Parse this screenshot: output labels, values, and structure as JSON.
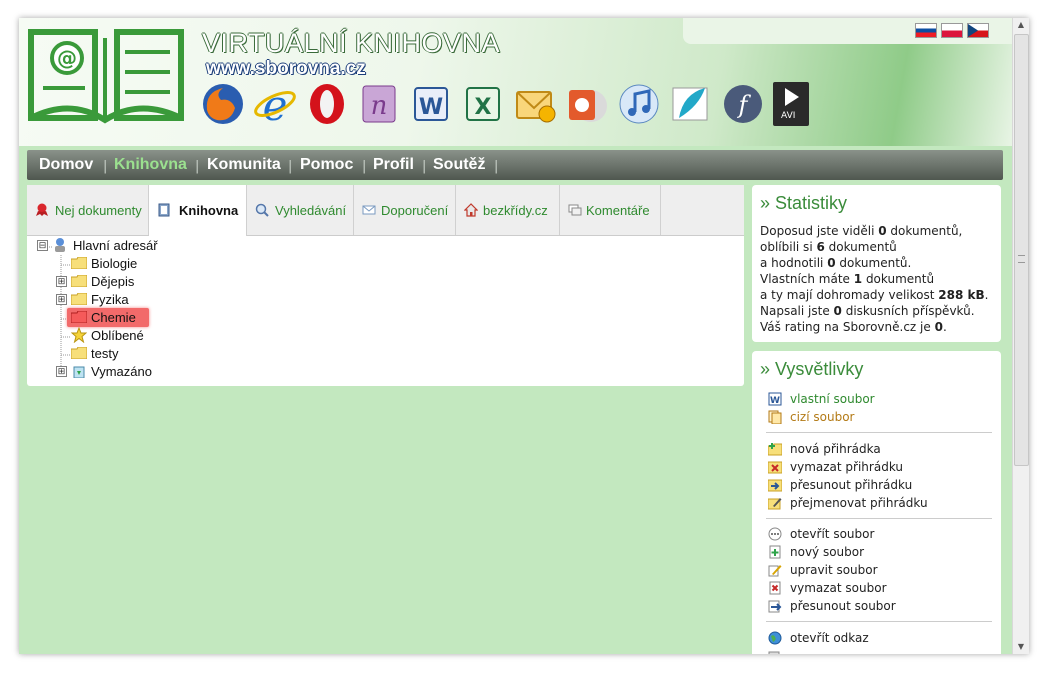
{
  "header": {
    "site_title": "VIRTUÁLNÍ KNIHOVNA",
    "site_url": "www.sborovna.cz",
    "languages": [
      "SK",
      "PL",
      "CZ"
    ],
    "app_icons": [
      "firefox-icon",
      "internet-explorer-icon",
      "opera-icon",
      "onenote-icon",
      "word-icon",
      "excel-icon",
      "outlook-icon",
      "powerpoint-icon",
      "music-icon",
      "feather-icon",
      "flash-icon",
      "avi-icon"
    ],
    "avi_label": "AVI"
  },
  "nav": {
    "items": [
      "Domov",
      "Knihovna",
      "Komunita",
      "Pomoc",
      "Profil",
      "Soutěž"
    ],
    "active": "Knihovna",
    "separator": "|"
  },
  "tabs": [
    "Nej dokumenty",
    "Knihovna",
    "Vyhledávání",
    "Doporučení",
    "bezkřídy.cz",
    "Komentáře"
  ],
  "active_tab": "Knihovna",
  "tree": {
    "root": "Hlavní adresář",
    "items": [
      "Biologie",
      "Dějepis",
      "Fyzika",
      "Chemie",
      "Oblíbené",
      "testy",
      "Vymazáno"
    ],
    "selected": "Chemie",
    "expanders": [
      "⊟",
      "⊞",
      "⊞",
      "⊞"
    ]
  },
  "stats": {
    "title": "» Statistiky",
    "lines": [
      {
        "a": "Doposud jste viděli ",
        "b": "0",
        "c": " dokumentů,"
      },
      {
        "a": "oblíbili si ",
        "b": "6",
        "c": " dokumentů"
      },
      {
        "a": "a hodnotili ",
        "b": "0",
        "c": " dokumentů."
      },
      {
        "a": "Vlastních máte ",
        "b": "1",
        "c": " dokumentů"
      },
      {
        "a": "a ty mají dohromady velikost ",
        "b": "288 kB",
        "c": "."
      },
      {
        "a": "Napsali jste ",
        "b": "0",
        "c": " diskusních příspěvků."
      },
      {
        "a": "Váš rating na Sborovně.cz je ",
        "b": "0",
        "c": "."
      }
    ]
  },
  "legend": {
    "title": "» Vysvětlivky",
    "files": [
      "vlastní soubor",
      "cizí soubor"
    ],
    "folders": [
      "nová přihrádka",
      "vymazat přihrádku",
      "přesunout přihrádku",
      "přejmenovat přihrádku"
    ],
    "file_actions": [
      "otevřít soubor",
      "nový soubor",
      "upravit soubor",
      "vymazat soubor",
      "přesunout soubor"
    ],
    "links": [
      "otevřít odkaz"
    ]
  },
  "colors": {
    "page_bg": "#c3e8bf",
    "accent": "#3b8c3b",
    "selected_bg": "#f26a6a",
    "nav_active": "#9be08f"
  }
}
